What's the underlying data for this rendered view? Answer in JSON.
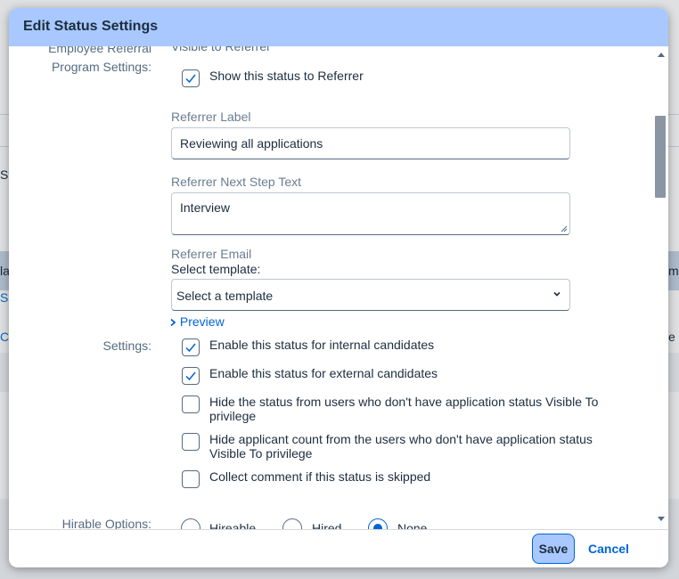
{
  "background": {
    "fragments": [
      "Sta",
      "la",
      "S",
      "C",
      "ma",
      "e"
    ]
  },
  "dialog": {
    "title": "Edit Status Settings",
    "save_label": "Save",
    "cancel_label": "Cancel"
  },
  "referral": {
    "section_label_partial": "Employee Referral",
    "section_label": "Program Settings:",
    "visible_to_referrer_partial": "Visible to Referrer",
    "show_to_referrer": {
      "label": "Show this status to Referrer",
      "checked": true
    },
    "referrer_label": {
      "label": "Referrer Label",
      "value": "Reviewing all applications"
    },
    "next_step": {
      "label": "Referrer Next Step Text",
      "value": "Interview"
    },
    "email": {
      "label": "Referrer Email",
      "select_label": "Select template:",
      "selected": "Select a template",
      "preview_label": "Preview"
    }
  },
  "settings": {
    "section_label": "Settings:",
    "options": [
      {
        "label": "Enable this status for internal candidates",
        "checked": true
      },
      {
        "label": "Enable this status for external candidates",
        "checked": true
      },
      {
        "label": "Hide the status from users who don't have application status Visible To privilege",
        "checked": false
      },
      {
        "label": "Hide applicant count from the users who don't have application status Visible To privilege",
        "checked": false
      },
      {
        "label": "Collect comment if this status is skipped",
        "checked": false
      }
    ]
  },
  "hirable": {
    "section_label": "Hirable Options:",
    "options": [
      "Hireable",
      "Hired",
      "None"
    ],
    "selected": "None"
  },
  "colors": {
    "header": "#a8c8ff",
    "accent": "#0064d9",
    "text": "#1d2d3e",
    "muted_label": "#556b82"
  }
}
